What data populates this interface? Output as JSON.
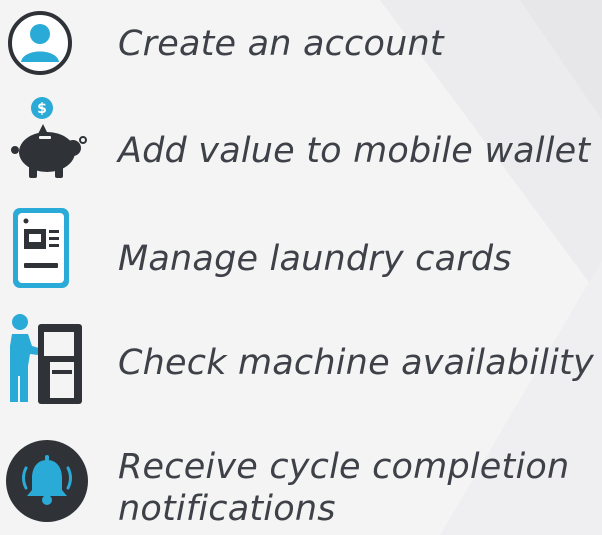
{
  "features": [
    {
      "label": "Create an account",
      "icon": "user-icon"
    },
    {
      "label": "Add value to mobile wallet",
      "icon": "piggy-bank-icon"
    },
    {
      "label": "Manage laundry cards",
      "icon": "card-device-icon"
    },
    {
      "label": "Check machine availability",
      "icon": "kiosk-user-icon"
    },
    {
      "label": "Receive cycle completion\nnotifications",
      "icon": "bell-icon"
    }
  ],
  "colors": {
    "accent": "#2aaad6",
    "dark": "#2f3338",
    "text": "#3e4148"
  }
}
